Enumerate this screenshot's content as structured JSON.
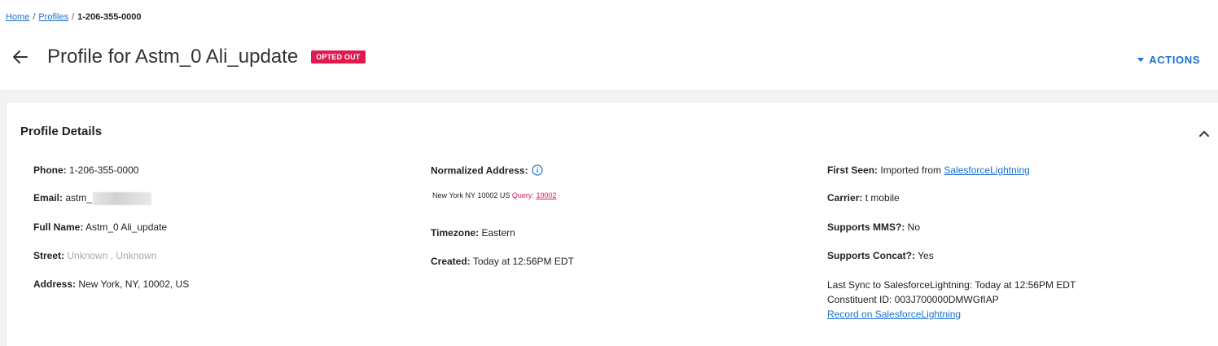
{
  "breadcrumb": {
    "home": "Home",
    "separator": "/",
    "profiles": "Profiles",
    "current": "1-206-355-0000"
  },
  "header": {
    "title": "Profile for Astm_0 Ali_update",
    "status_badge": "OPTED OUT",
    "actions_label": "ACTIONS"
  },
  "panel": {
    "title": "Profile Details"
  },
  "left": {
    "phone_label": "Phone:",
    "phone_value": "1-206-355-0000",
    "email_label": "Email:",
    "email_value": "astm_",
    "fullname_label": "Full Name:",
    "fullname_value": "Astm_0 Ali_update",
    "street_label": "Street:",
    "street_value_1": "Unknown",
    "street_sep": " , ",
    "street_value_2": "Unknown",
    "address_label": "Address:",
    "address_value": "New York, NY, 10002, US"
  },
  "middle": {
    "normalized_label": "Normalized Address:",
    "normalized_value": "New York NY 10002 US",
    "query_label": "Query:",
    "query_value": "10002",
    "timezone_label": "Timezone:",
    "timezone_value": "Eastern",
    "created_label": "Created:",
    "created_value": "Today at 12:56PM EDT"
  },
  "right": {
    "first_seen_label": "First Seen:",
    "first_seen_text": "Imported from",
    "first_seen_link": "SalesforceLightning",
    "carrier_label": "Carrier:",
    "carrier_value": "t mobile",
    "mms_label": "Supports MMS?:",
    "mms_value": "No",
    "concat_label": "Supports Concat?:",
    "concat_value": "Yes",
    "last_sync": "Last Sync to SalesforceLightning: Today at 12:56PM EDT",
    "constituent_id": "Constituent ID: 003J700000DMWGfIAP",
    "record_link": "Record on SalesforceLightning"
  },
  "colors": {
    "accent": "#1a6fd1",
    "badge": "#e0194e",
    "muted": "#a8a8a8"
  },
  "icons": {
    "back": "arrow-left-icon",
    "actions_caret": "caret-down-icon",
    "collapse": "chevron-up-icon",
    "info": "info-circle-icon"
  }
}
